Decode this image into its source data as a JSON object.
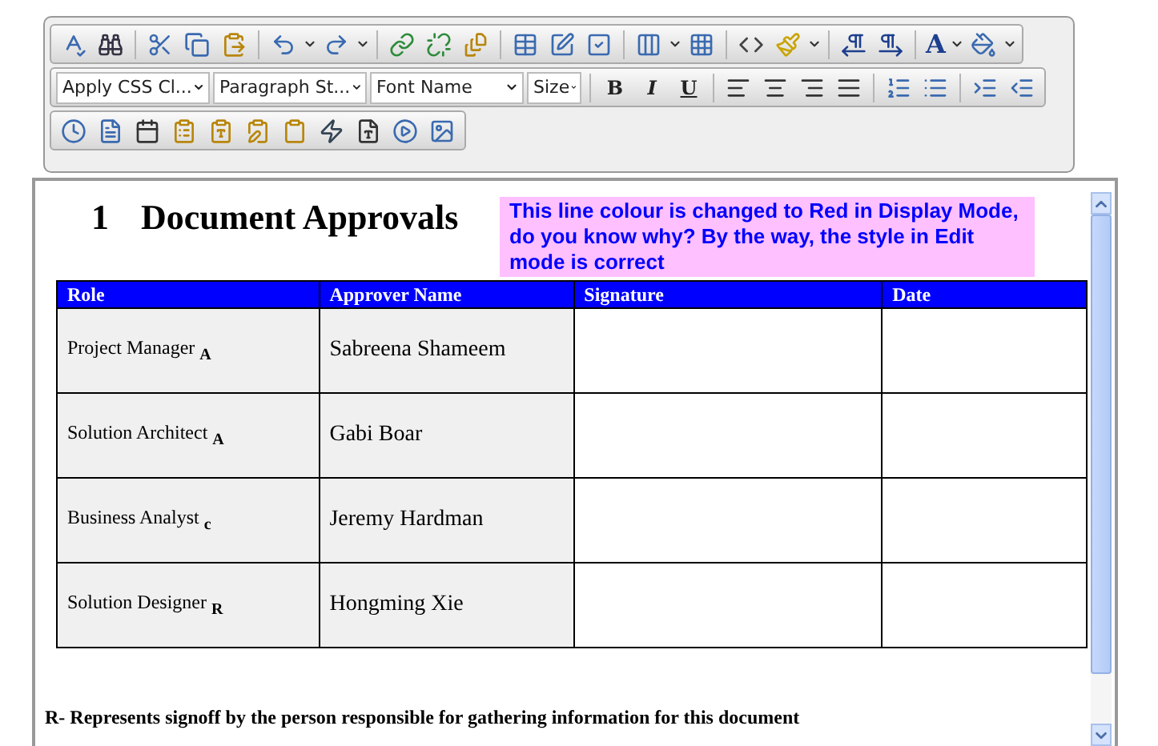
{
  "toolbar": {
    "dropdowns": [
      {
        "label": "Apply CSS Cl..."
      },
      {
        "label": "Paragraph St..."
      },
      {
        "label": "Font Name"
      },
      {
        "label": "Size"
      }
    ],
    "format_buttons": [
      {
        "label": "B",
        "kind": "bold"
      },
      {
        "label": "I",
        "kind": "italic"
      },
      {
        "label": "U",
        "kind": "underline"
      }
    ],
    "font_color": "A"
  },
  "document": {
    "heading_number": "1",
    "heading": "Document Approvals",
    "note": "This line colour is changed to Red in Display Mode, do you know why? By the way, the style in Edit mode is correct",
    "table": {
      "columns": [
        "Role",
        "Approver Name",
        "Signature",
        "Date"
      ],
      "rows": [
        {
          "role": "Project Manager $_{A}$",
          "name": "Sabreena Shameem"
        },
        {
          "role": "Solution Architect  $_{A}$",
          "name": "Gabi Boar"
        },
        {
          "role": "Business Analyst $_{c}$",
          "name": "Jeremy Hardman"
        },
        {
          "role": "Solution Designer $_{R}$",
          "name": "Hongming Xie"
        }
      ]
    },
    "footnote": "R- Represents signoff by the person responsible for gathering information for this document"
  }
}
